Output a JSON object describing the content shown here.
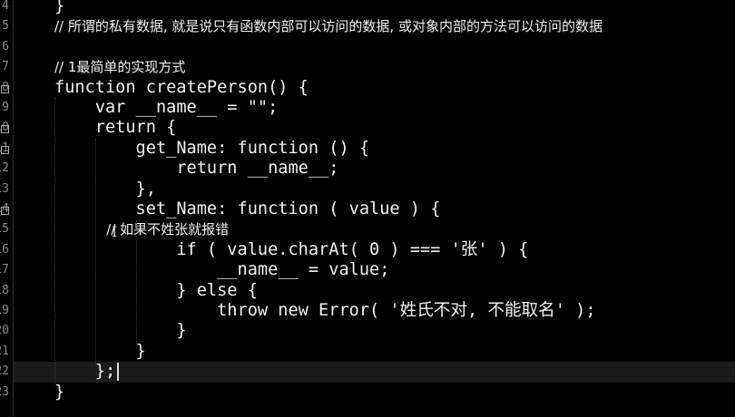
{
  "editor": {
    "lines": [
      {
        "n": "4",
        "text": "}"
      },
      {
        "n": "5",
        "text": "// 所谓的私有数据, 就是说只有函数内部可以访问的数据, 或对象内部的方法可以访问的数据",
        "comment": true
      },
      {
        "n": "6",
        "text": ""
      },
      {
        "n": "7",
        "text": "// 1最简单的实现方式",
        "comment": true
      },
      {
        "n": "8",
        "text": "function createPerson() {",
        "fold": true
      },
      {
        "n": "9",
        "text": "    var __name__ = \"\";"
      },
      {
        "n": "10",
        "text": "    return {",
        "fold": true
      },
      {
        "n": "11",
        "text": "        get_Name: function () {",
        "fold": true
      },
      {
        "n": "12",
        "text": "            return __name__;"
      },
      {
        "n": "13",
        "text": "        },"
      },
      {
        "n": "14",
        "text": "        set_Name: function ( value ) {",
        "fold": true
      },
      {
        "n": "15",
        "text": "            // 如果不姓张就报错",
        "comment": true
      },
      {
        "n": "16",
        "text": "            if ( value.charAt( 0 ) === '张' ) {"
      },
      {
        "n": "17",
        "text": "                __name__ = value;"
      },
      {
        "n": "18",
        "text": "            } else {"
      },
      {
        "n": "19",
        "text": "                throw new Error( '姓氏不对, 不能取名' );"
      },
      {
        "n": "20",
        "text": "            }"
      },
      {
        "n": "21",
        "text": "        }"
      },
      {
        "n": "22",
        "text": "    };",
        "current": true
      },
      {
        "n": "23",
        "text": "}"
      }
    ]
  }
}
